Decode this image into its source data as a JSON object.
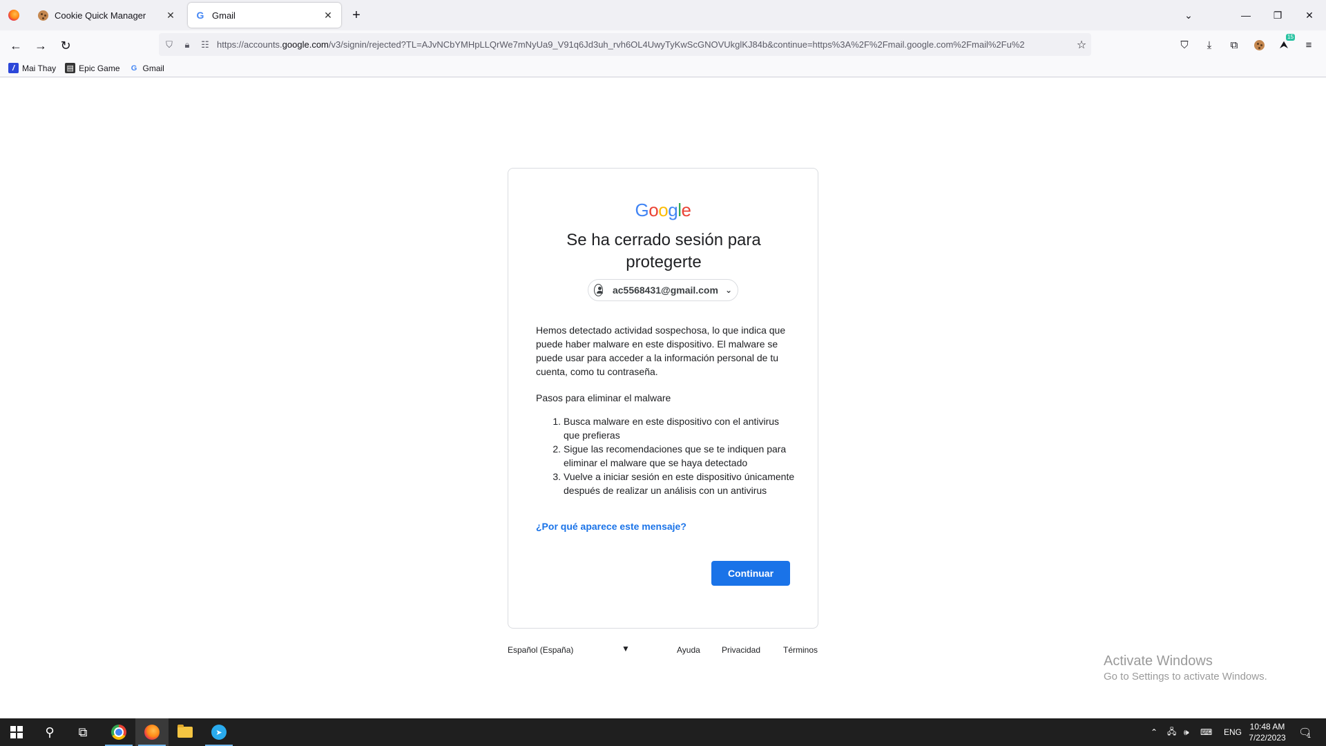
{
  "browser": {
    "tabs": [
      {
        "title": "Cookie Quick Manager",
        "icon": "cookie-icon"
      },
      {
        "title": "Gmail",
        "icon": "google-icon"
      }
    ],
    "url_prefix": "https://accounts.",
    "url_domain": "google.com",
    "url_rest": "/v3/signin/rejected?TL=AJvNCbYMHpLLQrWe7mNyUa9_V91q6Jd3uh_rvh6OL4UwyTyKwScGNOVUkglKJ84b&continue=https%3A%2F%2Fmail.google.com%2Fmail%2Fu%2",
    "extension_badge": "15",
    "bookmarks": [
      {
        "label": "Mai Thay",
        "icon": "mai-thay-icon"
      },
      {
        "label": "Epic Game",
        "icon": "epic-game-icon"
      },
      {
        "label": "Gmail",
        "icon": "google-icon"
      }
    ]
  },
  "page": {
    "logo_letters": [
      "G",
      "o",
      "o",
      "g",
      "l",
      "e"
    ],
    "heading": "Se ha cerrado sesión para protegerte",
    "account_email": "ac5568431@gmail.com",
    "body": "Hemos detectado actividad sospechosa, lo que indica que puede haber malware en este dispositivo. El malware se puede usar para acceder a la información personal de tu cuenta, como tu contraseña.",
    "steps_title": "Pasos para eliminar el malware",
    "steps": [
      {
        "num": "1.",
        "text": "Busca malware en este dispositivo con el antivirus que prefieras"
      },
      {
        "num": "2.",
        "text": "Sigue las recomendaciones que se te indiquen para eliminar el malware que se haya detectado"
      },
      {
        "num": "3.",
        "text": "Vuelve a iniciar sesión en este dispositivo únicamente después de realizar un análisis con un antivirus"
      }
    ],
    "why_link": "¿Por qué aparece este mensaje?",
    "continue_label": "Continuar",
    "colors": {
      "primary": "#1a73e8"
    }
  },
  "footer": {
    "language": "Español (España)",
    "links": [
      "Ayuda",
      "Privacidad",
      "Términos"
    ]
  },
  "watermark": {
    "line1": "Activate Windows",
    "line2": "Go to Settings to activate Windows."
  },
  "taskbar": {
    "lang": "ENG",
    "time": "10:48 AM",
    "date": "7/22/2023",
    "notification_count": "1"
  }
}
